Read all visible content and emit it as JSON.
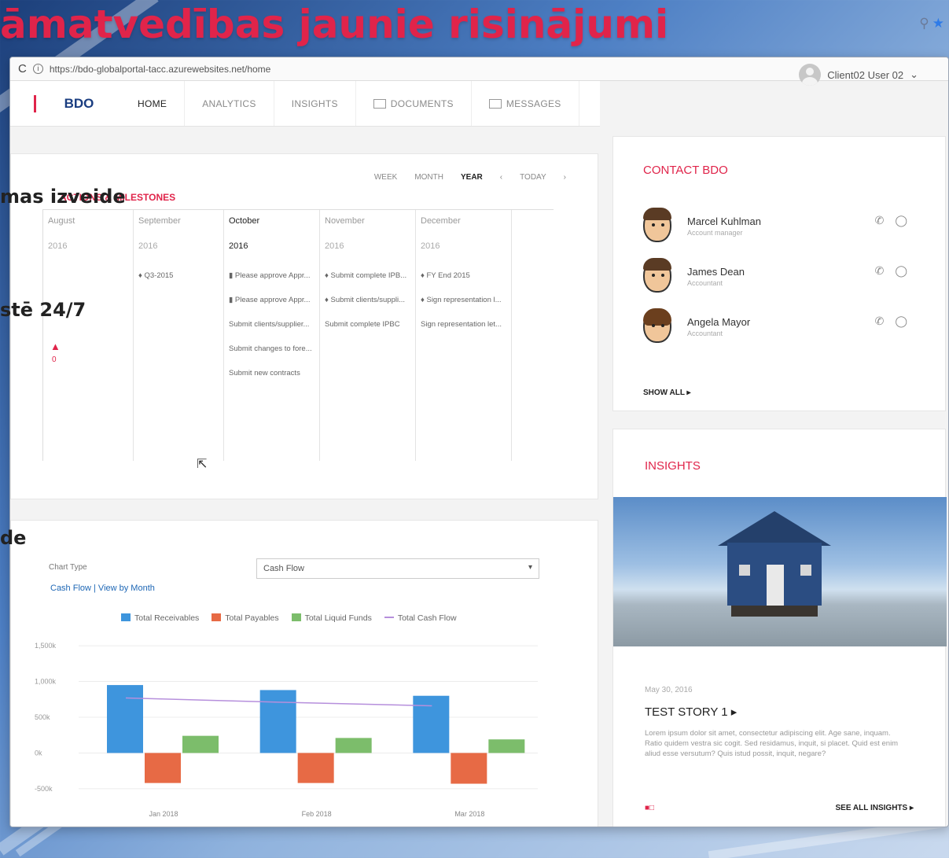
{
  "slide": {
    "title": "āmatvedības jaunie risinājumi",
    "overlay_lines": [
      "mas izveide",
      "stē 24/7",
      "de"
    ]
  },
  "browser": {
    "url": "https://bdo-globalportal-tacc.azurewebsites.net/home",
    "user_name": "Client02 User 02",
    "user_caret": "⌄"
  },
  "nav": {
    "logo": "BDO",
    "items": [
      "HOME",
      "ANALYTICS",
      "INSIGHTS",
      "DOCUMENTS",
      "MESSAGES"
    ]
  },
  "milestones": {
    "title": "ACTIONS & MILESTONES",
    "view_options": [
      "WEEK",
      "MONTH",
      "YEAR"
    ],
    "selected_view": "YEAR",
    "prev": "‹",
    "today": "TODAY",
    "next": "›",
    "alert_count": "0",
    "columns": [
      {
        "month": "August",
        "year": "2016",
        "events": []
      },
      {
        "month": "September",
        "year": "2016",
        "events": [
          "♦ Q3-2015"
        ]
      },
      {
        "month": "October",
        "year": "2016",
        "events": [
          "▮ Please approve Appr...",
          "▮ Please approve Appr...",
          "Submit clients/supplier...",
          "Submit changes to fore...",
          "Submit new contracts"
        ]
      },
      {
        "month": "November",
        "year": "2016",
        "events": [
          "♦ Submit complete IPB...",
          "♦ Submit clients/suppli...",
          "Submit complete IPBC"
        ]
      },
      {
        "month": "December",
        "year": "2016",
        "events": [
          "♦ FY End 2015",
          "♦ Sign representation l...",
          "Sign representation let..."
        ]
      }
    ]
  },
  "chart_panel": {
    "chart_type_label": "Chart Type",
    "chart_type_value": "Cash Flow",
    "subtitle": "Cash Flow | View by Month"
  },
  "chart_data": {
    "type": "bar",
    "categories": [
      "Jan 2018",
      "Feb 2018",
      "Mar 2018"
    ],
    "series": [
      {
        "name": "Total Receivables",
        "type": "bar",
        "color": "#3e95dd",
        "values": [
          950,
          880,
          800
        ]
      },
      {
        "name": "Total Payables",
        "type": "bar",
        "color": "#e76a45",
        "values": [
          -420,
          -420,
          -430
        ]
      },
      {
        "name": "Total Liquid Funds",
        "type": "bar",
        "color": "#7cbd6b",
        "values": [
          240,
          210,
          190
        ]
      },
      {
        "name": "Total Cash Flow",
        "type": "line",
        "color": "#b68fdc",
        "values": [
          770,
          710,
          660
        ]
      }
    ],
    "y_ticks": [
      "1,500k",
      "1,000k",
      "500k",
      "0k",
      "-500k"
    ],
    "y_tick_values": [
      1500,
      1000,
      500,
      0,
      -500
    ],
    "ylim": [
      -600,
      1600
    ],
    "legend_position": "top",
    "grid": true
  },
  "contact": {
    "title": "CONTACT BDO",
    "people": [
      {
        "name": "Marcel Kuhlman",
        "role": "Account manager"
      },
      {
        "name": "James Dean",
        "role": "Accountant"
      },
      {
        "name": "Angela Mayor",
        "role": "Accountant"
      }
    ],
    "phone_icon": "✆",
    "chat_icon": "◯",
    "show_all": "SHOW ALL ▸"
  },
  "insights": {
    "title": "INSIGHTS",
    "date": "May 30, 2016",
    "story_title": "TEST STORY 1 ▸",
    "body": "Lorem ipsum dolor sit amet, consectetur adipiscing elit. Age sane, inquam. Ratio quidem vestra sic cogit. Sed residamus, inquit, si placet. Quid est enim aliud esse versutum? Quis istud possit, inquit, negare?",
    "pager_icons": "■□",
    "see_all": "SEE ALL INSIGHTS ▸"
  }
}
